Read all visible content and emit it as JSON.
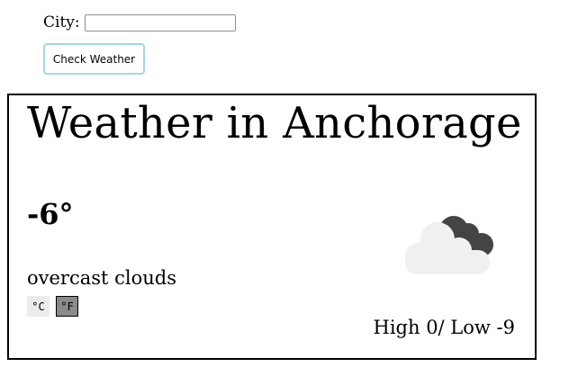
{
  "form": {
    "city_label": "City:",
    "city_value": "",
    "city_placeholder": "",
    "submit_label": "Check Weather"
  },
  "weather": {
    "title": "Weather in Anchorage",
    "temperature": "-6°",
    "description": "overcast clouds",
    "unit_celsius": "°C",
    "unit_fahrenheit": "°F",
    "selected_unit": "°F",
    "high_low": "High 0/ Low -9",
    "icon": "overcast-clouds-icon"
  },
  "colors": {
    "button_border": "#a4d7e1",
    "unit_selected_bg": "#8a8a8a",
    "unit_unselected_bg": "#ececec",
    "cloud_light": "#f0f0f0",
    "cloud_dark": "#444444"
  }
}
